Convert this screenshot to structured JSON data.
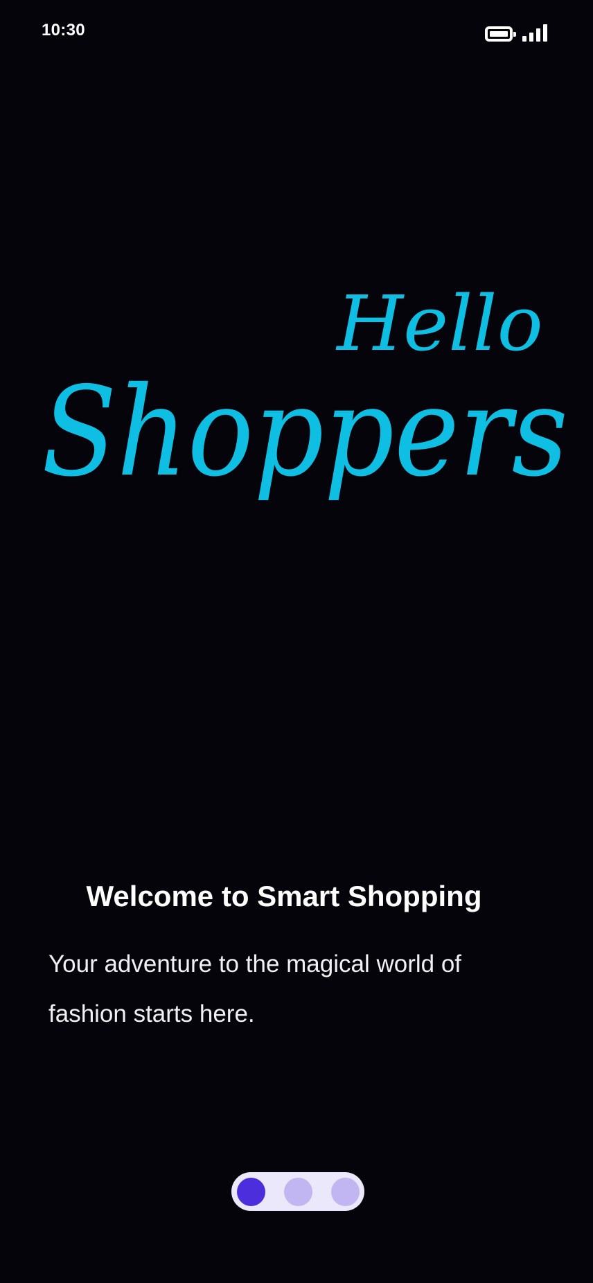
{
  "status_bar": {
    "time": "10:30",
    "icons": [
      "battery-icon",
      "signal-icon"
    ]
  },
  "logo": {
    "line1": "Hello",
    "line2": "Shoppers",
    "color": "#0ebfe3"
  },
  "onboarding": {
    "title": "Welcome to Smart Shopping",
    "description": "Your adventure to the magical world of fashion starts here."
  },
  "pager": {
    "total": 3,
    "active_index": 0,
    "active_color": "#4c2edd",
    "inactive_color": "#c1b5f2",
    "track_color": "#ece8fb"
  },
  "colors": {
    "background": "#05040a",
    "text": "#ffffff"
  }
}
